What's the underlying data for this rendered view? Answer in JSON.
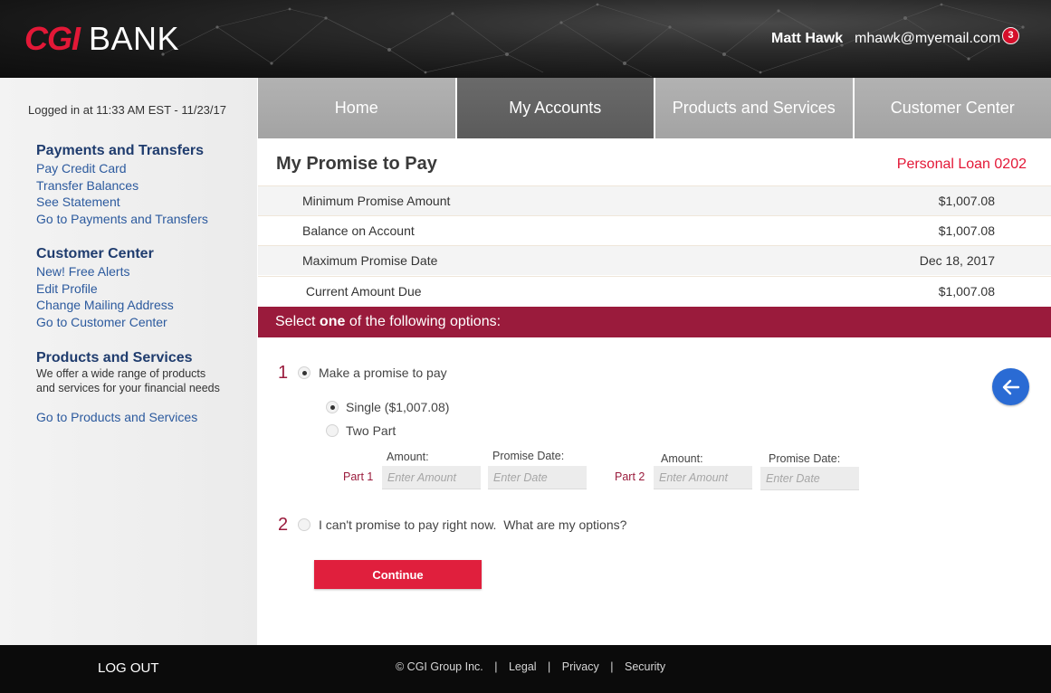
{
  "header": {
    "logo_primary": "CGI",
    "logo_secondary": "BANK",
    "user_name": "Matt Hawk",
    "user_email": "mhawk@myemail.com",
    "notification_count": "3"
  },
  "sidebar": {
    "logged_in_text": "Logged in at 11:33 AM EST - 11/23/17",
    "payments": {
      "heading": "Payments and Transfers",
      "links": [
        "Pay Credit Card",
        "Transfer Balances",
        "See Statement",
        "Go to Payments and Transfers"
      ]
    },
    "customer_center": {
      "heading": "Customer Center",
      "links": [
        "New! Free Alerts",
        "Edit Profile",
        "Change Mailing Address",
        "Go to Customer Center"
      ]
    },
    "products": {
      "heading": "Products and Services",
      "description_line1": "We offer a wide range of products",
      "description_line2": "and services for your financial needs",
      "link": "Go to Products and Services"
    }
  },
  "nav": {
    "tabs": [
      "Home",
      "My Accounts",
      "Products and Services",
      "Customer Center"
    ],
    "active": "My Accounts"
  },
  "main": {
    "title": "My Promise to Pay",
    "account_label": "Personal Loan 0202",
    "info_rows": [
      {
        "label": "Minimum Promise Amount",
        "value": "$1,007.08"
      },
      {
        "label": "Balance on Account",
        "value": "$1,007.08"
      },
      {
        "label": "Maximum Promise Date",
        "value": "Dec 18, 2017"
      },
      {
        "label": " Current Amount Due",
        "value": "$1,007.08"
      }
    ],
    "options_bar": {
      "prefix": "Select ",
      "emphasis": "one",
      "suffix": " of the following options:"
    },
    "option1": {
      "number": "1",
      "label": "Make a promise to pay",
      "single_label": "Single ($1,007.08)",
      "two_part_label": "Two Part",
      "part1_label": "Part 1",
      "part2_label": "Part 2",
      "amount_label": "Amount:",
      "date_label": "Promise Date:",
      "amount_placeholder": "Enter Amount",
      "date_placeholder": "Enter Date"
    },
    "option2": {
      "number": "2",
      "label": "I can't promise to pay right now.  What are my options?"
    },
    "continue_label": "Continue"
  },
  "footer": {
    "logout_label": "LOG OUT",
    "copyright": "© CGI Group Inc.",
    "links": [
      "Legal",
      "Privacy",
      "Security"
    ],
    "separator": "|"
  },
  "colors": {
    "brand_red": "#e31837",
    "maroon": "#9a1b3c",
    "link_blue": "#2c5a9e",
    "heading_navy": "#1f3c6e",
    "back_button_blue": "#2a6bd4"
  },
  "icons": {
    "back_button": "arrow-left-icon"
  }
}
